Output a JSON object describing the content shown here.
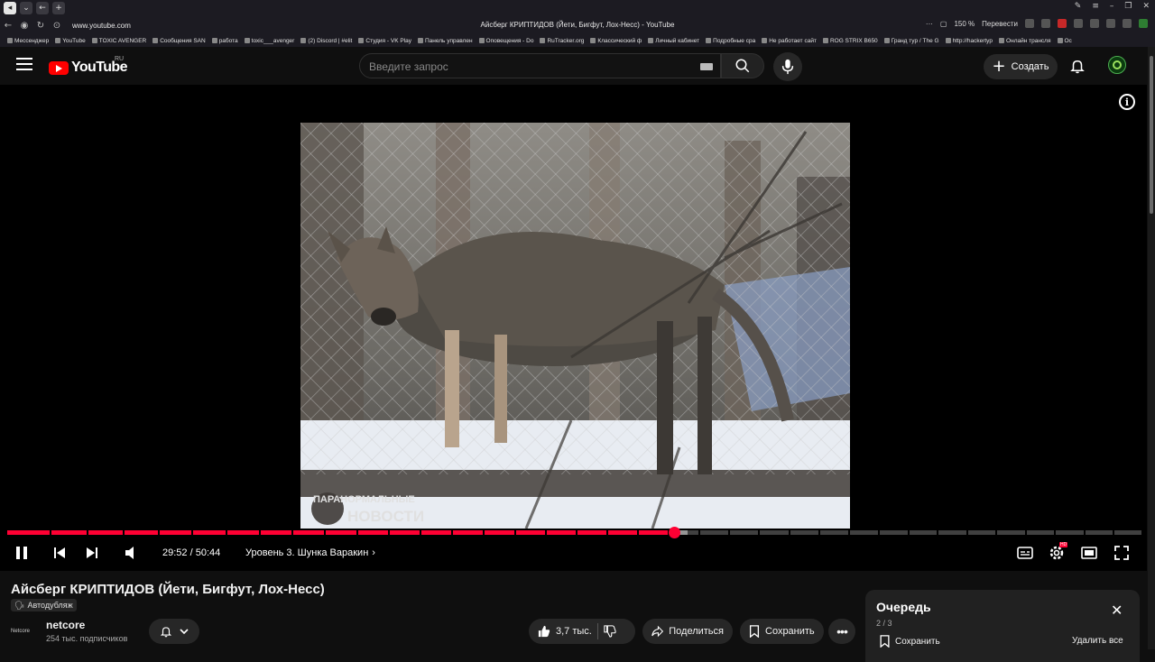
{
  "browser": {
    "page_title": "Айсберг КРИПТИДОВ (Йети, Бигфут, Лох-Несс) - YouTube",
    "url": "www.youtube.com",
    "zoom": "150 %",
    "translate_label": "Перевести",
    "bookmarks": [
      "Мессенджер",
      "YouTube",
      "TOXIC AVENGER",
      "Сообщения SAN",
      "работа",
      "toxic___avenger",
      "(2) Discord | #elit",
      "Студия - VK Play",
      "Панель управлен",
      "Оповещения - Do",
      "RuTracker.org",
      "Классический ф",
      "Личный кабинет",
      "Подробные сра",
      "Не работает сайт",
      "ROG STRIX B650",
      "Гранд тур / The G",
      "http://hackertyp",
      "Онлайн трансля",
      "Ос"
    ]
  },
  "header": {
    "logo_text": "YouTube",
    "region": "RU",
    "search_placeholder": "Введите запрос",
    "create_label": "Создать"
  },
  "player": {
    "watermark_line1": "ПАРАНОРМАЛЬНЫЕ",
    "watermark_line2": "НОВОСТИ",
    "time_current": "29:52",
    "time_separator": " / ",
    "time_total": "50:44",
    "chapter_title": "Уровень 3. Шунка Варакин",
    "progress_played_fraction": 0.588,
    "progress_buffered_fraction": 0.6,
    "quality_badge": "HD"
  },
  "video": {
    "title": "Айсберг КРИПТИДОВ (Йети, Бигфут, Лох-Несс)",
    "autodub_label": "Автодубляж",
    "channel_avatar_text": "Netcore",
    "channel_name": "netcore",
    "subscribers": "254 тыс. подписчиков",
    "likes": "3,7 тыс.",
    "share_label": "Поделиться",
    "save_label": "Сохранить"
  },
  "queue": {
    "title": "Очередь",
    "count": "2 / 3",
    "save_label": "Сохранить",
    "remove_all_label": "Удалить все"
  },
  "colors": {
    "accent": "#ff0033",
    "background": "#0f0f0f",
    "surface": "#272727"
  }
}
